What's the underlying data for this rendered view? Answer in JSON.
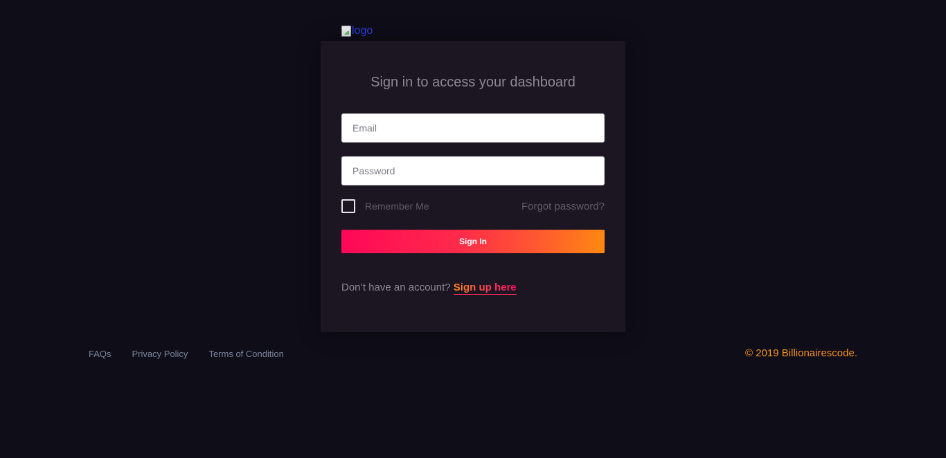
{
  "logo": {
    "alt": "logo"
  },
  "login_card": {
    "title": "Sign in to access your dashboard",
    "email_placeholder": "Email",
    "password_placeholder": "Password",
    "remember_label": "Remember Me",
    "remember_checked": false,
    "forgot_label": "Forgot password?",
    "signin_label": "Sign In",
    "signup_prompt": "Don’t have an account?",
    "signup_link": "Sign up here"
  },
  "footer": {
    "links": [
      "FAQs",
      "Privacy Policy",
      "Terms of Condition"
    ],
    "copyright": "© 2019 Billionairescode."
  },
  "colors": {
    "background": "#0f0d18",
    "card": "#1b1621",
    "accent_start": "#ff0758",
    "accent_end": "#ff8a0f",
    "copyright": "#f7941d"
  }
}
